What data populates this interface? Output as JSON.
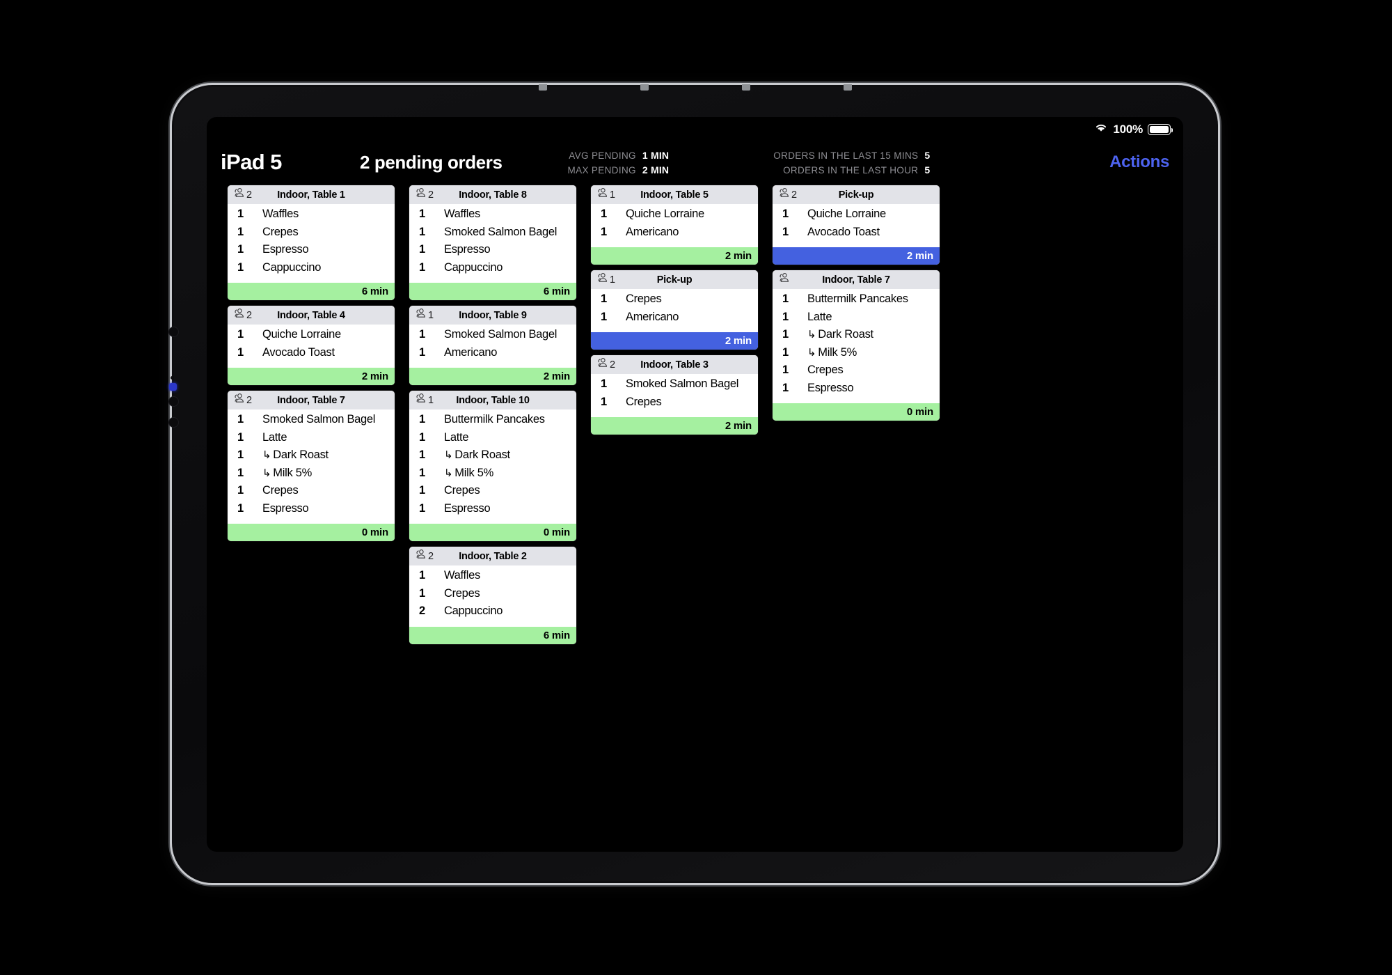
{
  "status_bar": {
    "wifi_icon": "wifi-icon",
    "battery_percent": "100%",
    "battery_icon": "battery-full-icon"
  },
  "header": {
    "device_name": "iPad 5",
    "pending_title": "2 pending orders",
    "actions_label": "Actions",
    "stats": [
      {
        "label": "AVG PENDING",
        "value": "1 MIN"
      },
      {
        "label": "MAX PENDING",
        "value": "2 MIN"
      },
      {
        "label": "ORDERS IN THE LAST 15 MINS",
        "value": "5"
      },
      {
        "label": "ORDERS IN THE LAST HOUR",
        "value": "5"
      }
    ]
  },
  "colors": {
    "green": "#a5f0a0",
    "blue": "#4461e0",
    "header_strip": "#e2e3e8",
    "accent": "#4d63f0"
  },
  "columns": [
    {
      "cards": [
        {
          "guests": "2",
          "title": "Indoor, Table 1",
          "elapsed": "6 min",
          "status": "green",
          "items": [
            {
              "qty": "1",
              "name": "Waffles",
              "sub": false
            },
            {
              "qty": "1",
              "name": "Crepes",
              "sub": false
            },
            {
              "qty": "1",
              "name": "Espresso",
              "sub": false
            },
            {
              "qty": "1",
              "name": "Cappuccino",
              "sub": false
            }
          ]
        },
        {
          "guests": "2",
          "title": "Indoor, Table 4",
          "elapsed": "2 min",
          "status": "green",
          "items": [
            {
              "qty": "1",
              "name": "Quiche Lorraine",
              "sub": false
            },
            {
              "qty": "1",
              "name": "Avocado Toast",
              "sub": false
            }
          ]
        },
        {
          "guests": "2",
          "title": "Indoor, Table 7",
          "elapsed": "0 min",
          "status": "green",
          "items": [
            {
              "qty": "1",
              "name": "Smoked Salmon Bagel",
              "sub": false
            },
            {
              "qty": "1",
              "name": "Latte",
              "sub": false
            },
            {
              "qty": "1",
              "name": "Dark Roast",
              "sub": true
            },
            {
              "qty": "1",
              "name": "Milk 5%",
              "sub": true
            },
            {
              "qty": "1",
              "name": "Crepes",
              "sub": false
            },
            {
              "qty": "1",
              "name": "Espresso",
              "sub": false
            }
          ]
        }
      ]
    },
    {
      "cards": [
        {
          "guests": "2",
          "title": "Indoor, Table 8",
          "elapsed": "6 min",
          "status": "green",
          "items": [
            {
              "qty": "1",
              "name": "Waffles",
              "sub": false
            },
            {
              "qty": "1",
              "name": "Smoked Salmon Bagel",
              "sub": false
            },
            {
              "qty": "1",
              "name": "Espresso",
              "sub": false
            },
            {
              "qty": "1",
              "name": "Cappuccino",
              "sub": false
            }
          ]
        },
        {
          "guests": "1",
          "title": "Indoor, Table 9",
          "elapsed": "2 min",
          "status": "green",
          "items": [
            {
              "qty": "1",
              "name": "Smoked Salmon Bagel",
              "sub": false
            },
            {
              "qty": "1",
              "name": "Americano",
              "sub": false
            }
          ]
        },
        {
          "guests": "1",
          "title": "Indoor, Table 10",
          "elapsed": "0 min",
          "status": "green",
          "items": [
            {
              "qty": "1",
              "name": "Buttermilk Pancakes",
              "sub": false
            },
            {
              "qty": "1",
              "name": "Latte",
              "sub": false
            },
            {
              "qty": "1",
              "name": "Dark Roast",
              "sub": true
            },
            {
              "qty": "1",
              "name": "Milk 5%",
              "sub": true
            },
            {
              "qty": "1",
              "name": "Crepes",
              "sub": false
            },
            {
              "qty": "1",
              "name": "Espresso",
              "sub": false
            }
          ]
        },
        {
          "guests": "2",
          "title": "Indoor, Table 2",
          "elapsed": "6 min",
          "status": "green",
          "items": [
            {
              "qty": "1",
              "name": "Waffles",
              "sub": false
            },
            {
              "qty": "1",
              "name": "Crepes",
              "sub": false
            },
            {
              "qty": "2",
              "name": "Cappuccino",
              "sub": false
            }
          ]
        }
      ]
    },
    {
      "cards": [
        {
          "guests": "1",
          "title": "Indoor, Table 5",
          "elapsed": "2 min",
          "status": "green",
          "items": [
            {
              "qty": "1",
              "name": "Quiche Lorraine",
              "sub": false
            },
            {
              "qty": "1",
              "name": "Americano",
              "sub": false
            }
          ]
        },
        {
          "guests": "1",
          "title": "Pick-up",
          "elapsed": "2 min",
          "status": "blue",
          "items": [
            {
              "qty": "1",
              "name": "Crepes",
              "sub": false
            },
            {
              "qty": "1",
              "name": "Americano",
              "sub": false
            }
          ]
        },
        {
          "guests": "2",
          "title": "Indoor, Table 3",
          "elapsed": "2 min",
          "status": "green",
          "items": [
            {
              "qty": "1",
              "name": "Smoked Salmon Bagel",
              "sub": false
            },
            {
              "qty": "1",
              "name": "Crepes",
              "sub": false
            }
          ]
        }
      ]
    },
    {
      "cards": [
        {
          "guests": "2",
          "title": "Pick-up",
          "elapsed": "2 min",
          "status": "blue",
          "items": [
            {
              "qty": "1",
              "name": "Quiche Lorraine",
              "sub": false
            },
            {
              "qty": "1",
              "name": "Avocado Toast",
              "sub": false
            }
          ]
        },
        {
          "guests": "",
          "title": "Indoor, Table 7",
          "elapsed": "0 min",
          "status": "green",
          "items": [
            {
              "qty": "1",
              "name": "Buttermilk Pancakes",
              "sub": false
            },
            {
              "qty": "1",
              "name": "Latte",
              "sub": false
            },
            {
              "qty": "1",
              "name": "Dark Roast",
              "sub": true
            },
            {
              "qty": "1",
              "name": "Milk 5%",
              "sub": true
            },
            {
              "qty": "1",
              "name": "Crepes",
              "sub": false
            },
            {
              "qty": "1",
              "name": "Espresso",
              "sub": false
            }
          ]
        }
      ]
    }
  ]
}
